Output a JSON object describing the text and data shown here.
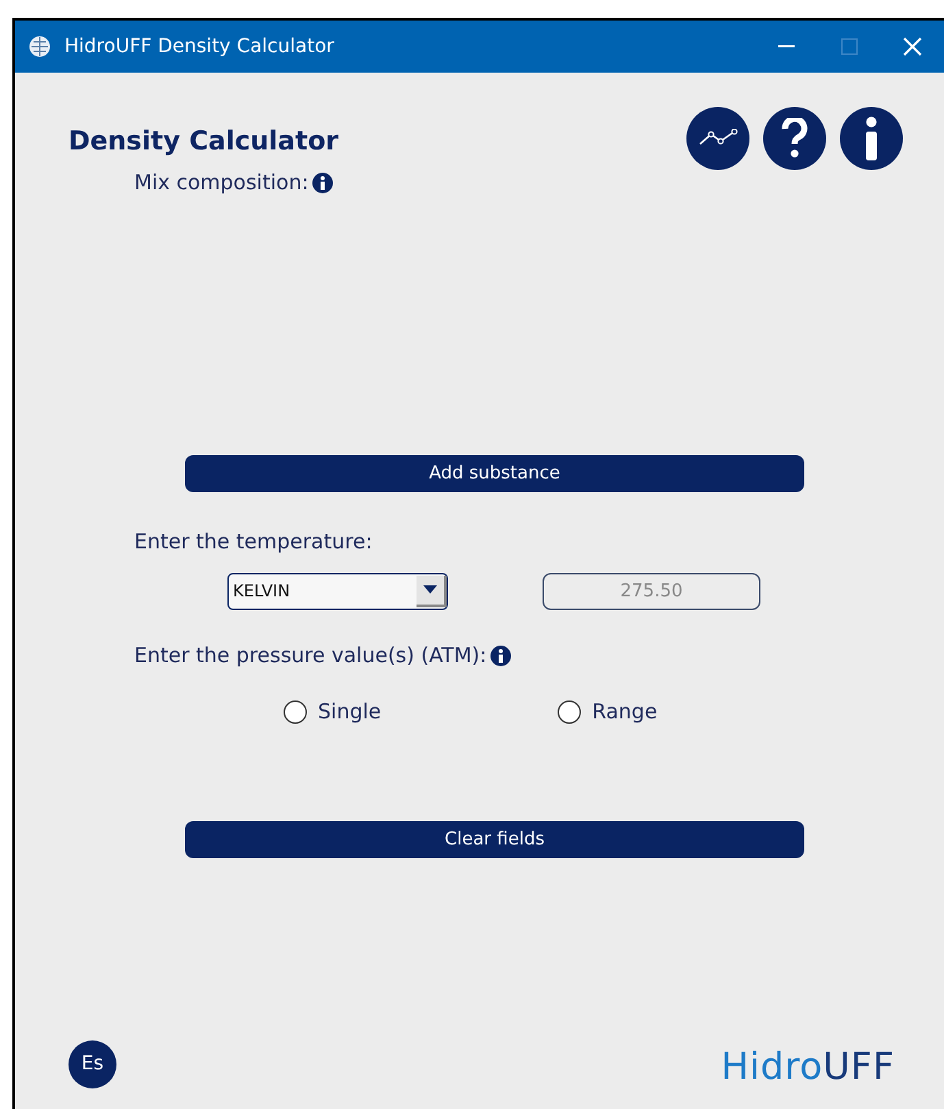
{
  "window": {
    "title": "HidroUFF Density Calculator"
  },
  "heading": "Density Calculator",
  "mix_label": "Mix composition:",
  "add_button": "Add substance",
  "temperature": {
    "label": "Enter the temperature:",
    "unit": "KELVIN",
    "value": "275.50"
  },
  "pressure": {
    "label": "Enter the pressure value(s) (ATM):",
    "options": [
      {
        "label": "Single",
        "selected": false
      },
      {
        "label": "Range",
        "selected": false
      }
    ]
  },
  "clear_button": "Clear fields",
  "language_button": "Es",
  "logo": {
    "part_1": "Hidro",
    "part_2": "UFF"
  }
}
